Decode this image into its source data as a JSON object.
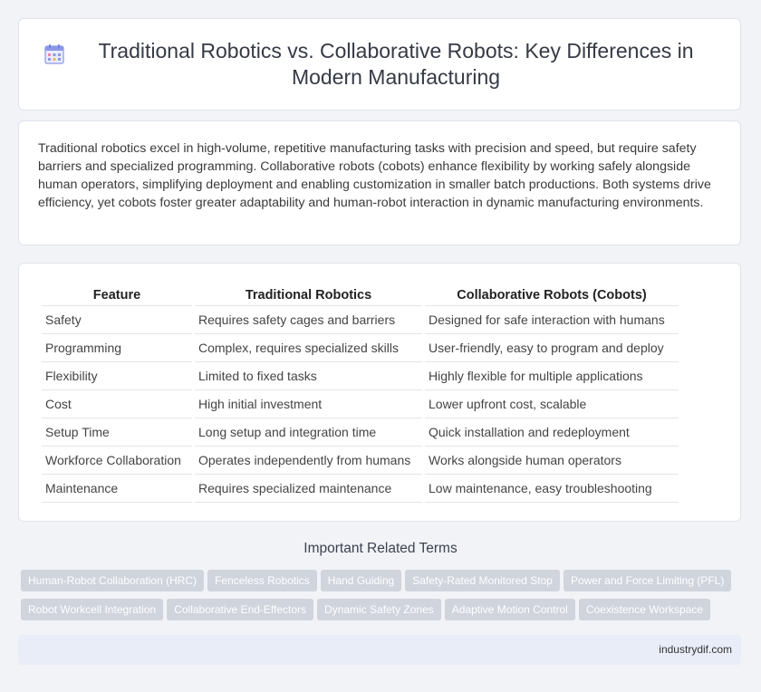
{
  "header": {
    "icon": "calendar-grid-icon",
    "title": "Traditional Robotics vs. Collaborative Robots: Key Differences in Modern Manufacturing"
  },
  "summary": "Traditional robotics excel in high-volume, repetitive manufacturing tasks with precision and speed, but require safety barriers and specialized programming. Collaborative robots (cobots) enhance flexibility by working safely alongside human operators, simplifying deployment and enabling customization in smaller batch productions. Both systems drive efficiency, yet cobots foster greater adaptability and human-robot interaction in dynamic manufacturing environments.",
  "table": {
    "headers": [
      "Feature",
      "Traditional Robotics",
      "Collaborative Robots (Cobots)"
    ],
    "rows": [
      [
        "Safety",
        "Requires safety cages and barriers",
        "Designed for safe interaction with humans"
      ],
      [
        "Programming",
        "Complex, requires specialized skills",
        "User-friendly, easy to program and deploy"
      ],
      [
        "Flexibility",
        "Limited to fixed tasks",
        "Highly flexible for multiple applications"
      ],
      [
        "Cost",
        "High initial investment",
        "Lower upfront cost, scalable"
      ],
      [
        "Setup Time",
        "Long setup and integration time",
        "Quick installation and redeployment"
      ],
      [
        "Workforce Collaboration",
        "Operates independently from humans",
        "Works alongside human operators"
      ],
      [
        "Maintenance",
        "Requires specialized maintenance",
        "Low maintenance, easy troubleshooting"
      ]
    ]
  },
  "related": {
    "title": "Important Related Terms",
    "tags": [
      "Human-Robot Collaboration (HRC)",
      "Fenceless Robotics",
      "Hand Guiding",
      "Safety-Rated Monitored Stop",
      "Power and Force Limiting (PFL)",
      "Robot Workcell Integration",
      "Collaborative End-Effectors",
      "Dynamic Safety Zones",
      "Adaptive Motion Control",
      "Coexistence Workspace"
    ]
  },
  "footer": {
    "site": "industrydif.com"
  },
  "colors": {
    "accent": "#6c7ee1",
    "tag_bg": "#d0d4dd",
    "footer_bg": "#e8edf8"
  }
}
